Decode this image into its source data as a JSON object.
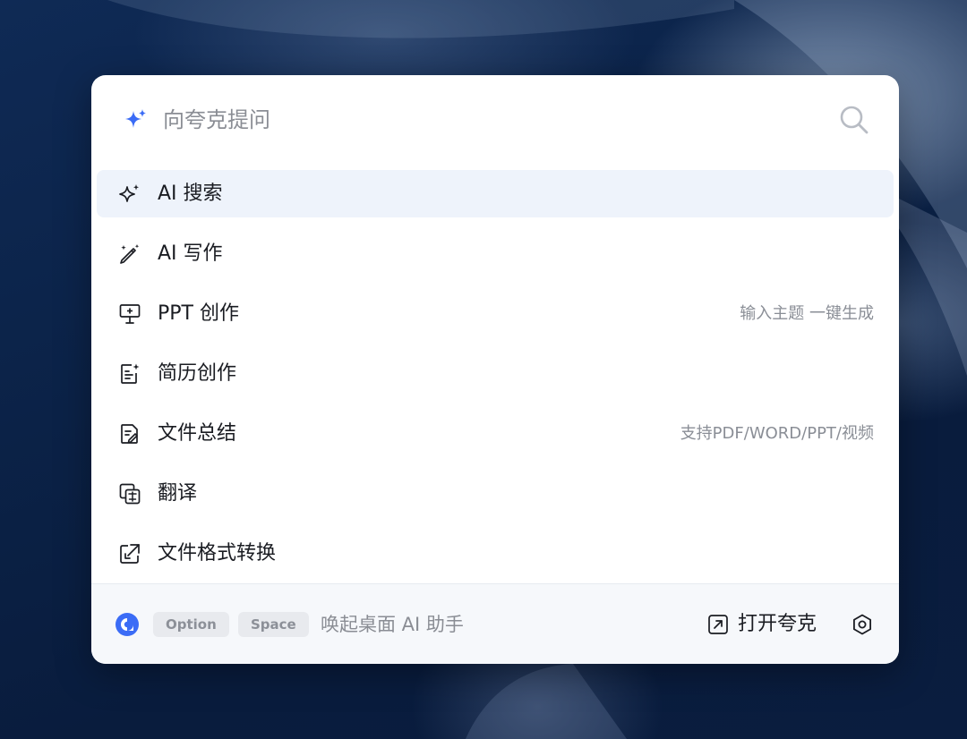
{
  "search": {
    "placeholder": "向夸克提问",
    "value": "",
    "leading_icon": "sparkle-icon",
    "trailing_icon": "search-icon"
  },
  "menu": {
    "items": [
      {
        "label": "AI 搜索",
        "hint": "",
        "icon": "ai-sparkle-icon",
        "active": true
      },
      {
        "label": "AI 写作",
        "hint": "",
        "icon": "magic-pen-icon",
        "active": false
      },
      {
        "label": "PPT 创作",
        "hint": "输入主题 一键生成",
        "icon": "presentation-icon",
        "active": false
      },
      {
        "label": "简历创作",
        "hint": "",
        "icon": "resume-icon",
        "active": false
      },
      {
        "label": "文件总结",
        "hint": "支持PDF/WORD/PPT/视频",
        "icon": "document-summary-icon",
        "active": false
      },
      {
        "label": "翻译",
        "hint": "",
        "icon": "translate-icon",
        "active": false
      },
      {
        "label": "文件格式转换",
        "hint": "",
        "icon": "file-convert-icon",
        "active": false
      }
    ]
  },
  "footer": {
    "logo_icon": "quark-logo-icon",
    "keys": [
      "Option",
      "Space"
    ],
    "shortcut_hint": "唤起桌面 AI 助手",
    "open_label": "打开夸克",
    "open_icon": "external-link-icon",
    "settings_icon": "settings-icon"
  },
  "colors": {
    "accent": "#3b6cf6",
    "active_row": "#eef3fb",
    "hint_text": "#8a8e96",
    "panel": "#ffffff",
    "footer": "#f6f8fb"
  }
}
